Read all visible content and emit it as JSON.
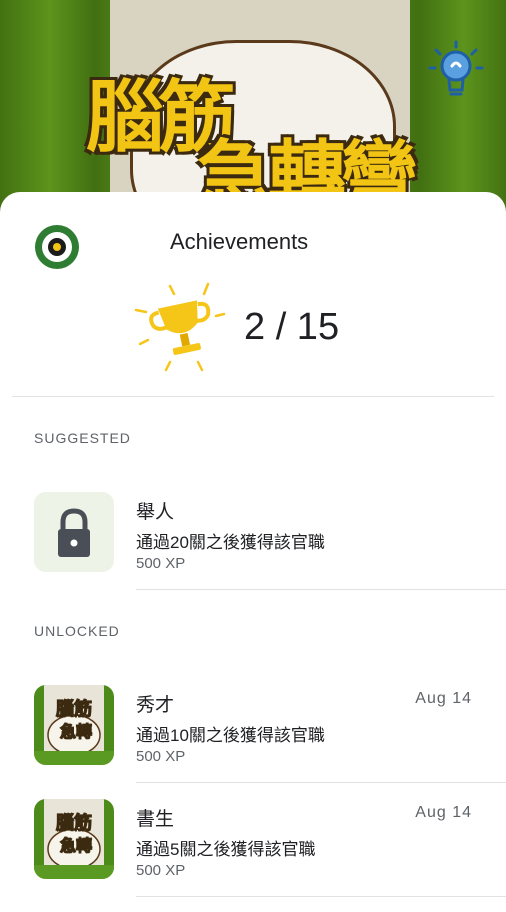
{
  "sheet": {
    "title": "Achievements",
    "count": "2 / 15"
  },
  "sections": {
    "suggested": "SUGGESTED",
    "unlocked": "UNLOCKED"
  },
  "suggested_items": [
    {
      "name": "舉人",
      "desc": "通過20關之後獲得該官職",
      "xp": "500 XP",
      "icon": "lock-icon"
    }
  ],
  "unlocked_items": [
    {
      "name": "秀才",
      "desc": "通過10關之後獲得該官職",
      "xp": "500 XP",
      "date": "Aug 14",
      "icon": "game-logo"
    },
    {
      "name": "書生",
      "desc": "通過5關之後獲得該官職",
      "xp": "500 XP",
      "date": "Aug 14",
      "icon": "game-logo"
    }
  ],
  "colors": {
    "background_green": "#4b7b16",
    "title_yellow": "#f2c414",
    "trophy_gold": "#f5c518",
    "text_primary": "#202124",
    "text_secondary": "#5f6368"
  }
}
